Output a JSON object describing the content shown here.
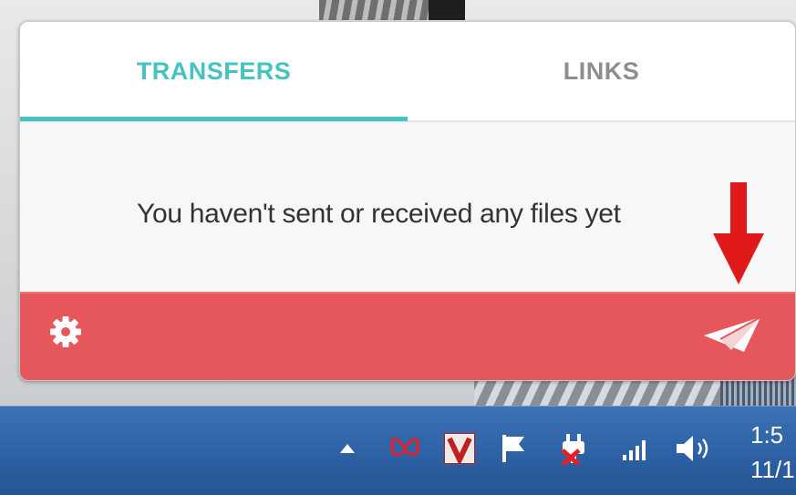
{
  "tabs": [
    {
      "label": "TRANSFERS",
      "active": true
    },
    {
      "label": "LINKS",
      "active": false
    }
  ],
  "empty_state": {
    "message": "You haven't sent or received any files yet"
  },
  "footer": {
    "settings_icon": "gear-icon",
    "send_icon": "paper-plane-icon"
  },
  "annotation": {
    "icon": "red-arrow-down-icon",
    "color": "#e01a1a"
  },
  "colors": {
    "accent": "#46c3c1",
    "footer": "#e5575a",
    "taskbar": "#2f64a6"
  },
  "taskbar": {
    "tray_icons": [
      "show-hidden-icons-arrow-icon",
      "butterfly-icon",
      "v-app-icon",
      "action-center-flag-icon",
      "power-plug-icon",
      "network-signal-icon",
      "volume-icon"
    ],
    "clock": {
      "time": "1:5",
      "date": "11/1"
    }
  }
}
